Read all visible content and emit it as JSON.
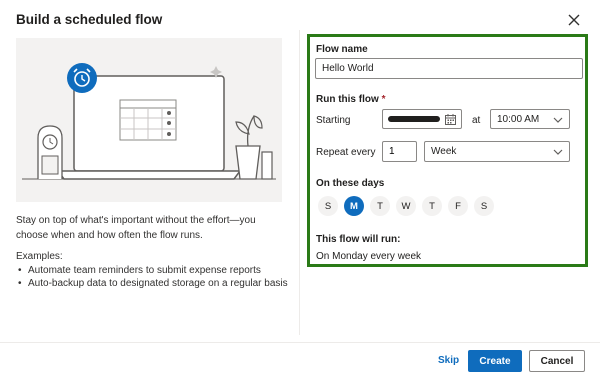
{
  "dialog": {
    "title": "Build a scheduled flow",
    "close_icon": "close-icon"
  },
  "left": {
    "description": "Stay on top of what's important without the effort—you choose when and how often the flow runs.",
    "examples_label": "Examples:",
    "examples": [
      "Automate team reminders to submit expense reports",
      "Auto-backup data to designated storage on a regular basis"
    ]
  },
  "form": {
    "flow_name_label": "Flow name",
    "flow_name_value": "Hello World",
    "run_label": "Run this flow",
    "required_marker": "*",
    "starting_label": "Starting",
    "at_label": "at",
    "time_value": "10:00 AM",
    "repeat_label": "Repeat every",
    "interval_value": "1",
    "frequency_value": "Week",
    "days_label": "On these days",
    "days": [
      {
        "label": "S",
        "selected": false
      },
      {
        "label": "M",
        "selected": true
      },
      {
        "label": "T",
        "selected": false
      },
      {
        "label": "W",
        "selected": false
      },
      {
        "label": "T",
        "selected": false
      },
      {
        "label": "F",
        "selected": false
      },
      {
        "label": "S",
        "selected": false
      }
    ],
    "summary_label": "This flow will run:",
    "summary_value": "On Monday every week"
  },
  "footer": {
    "skip_label": "Skip",
    "create_label": "Create",
    "cancel_label": "Cancel"
  },
  "colors": {
    "accent": "#0f6cbd",
    "highlight_border": "#2a7a17",
    "required": "#a4262c"
  }
}
